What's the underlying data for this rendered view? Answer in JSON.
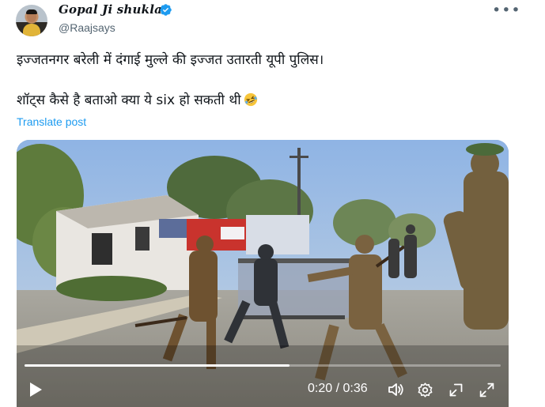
{
  "author": {
    "name": "Gopal Ji shukla",
    "handle": "@Raajsays"
  },
  "post": {
    "line1": "इज्जतनगर बरेली में दंगाई मुल्ले की इज्जत उतारती यूपी पुलिस।",
    "line2": "शॉट्स कैसे है बताओ क्या ये six हो सकती थी",
    "translate_label": "Translate post"
  },
  "video": {
    "current_time": "0:20",
    "separator": " / ",
    "duration": "0:36",
    "progress": 0.556
  },
  "icons": [
    "verified-badge-icon",
    "more-options-icon",
    "rofl-emoji-icon",
    "play-icon",
    "volume-icon",
    "settings-icon",
    "minimize-icon",
    "fullscreen-icon"
  ],
  "colors": {
    "accent": "#1d9bf0",
    "secondary_text": "#536471",
    "text": "#0f1419"
  }
}
